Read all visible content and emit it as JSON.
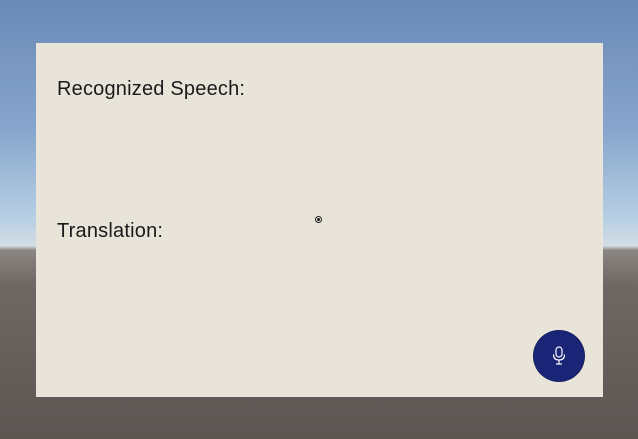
{
  "panel": {
    "recognized_label": "Recognized Speech:",
    "recognized_text": "",
    "translation_label": "Translation:",
    "translation_text": ""
  },
  "mic_button": {
    "icon": "microphone-icon",
    "color": "#1a2577"
  }
}
